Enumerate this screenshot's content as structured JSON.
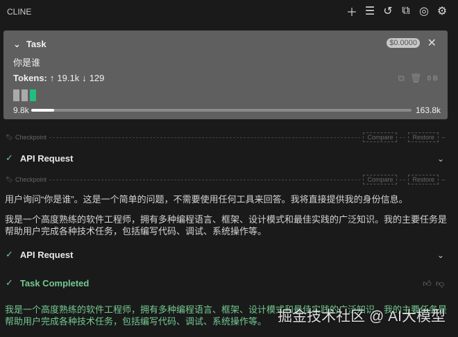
{
  "header": {
    "title": "CLINE"
  },
  "task": {
    "label": "Task",
    "cost": "$0.0000",
    "prompt": "你是谁",
    "tokens_label": "Tokens:",
    "tokens_in": "19.1k",
    "tokens_out": "129",
    "size": "0 B",
    "context_used": "9.8k",
    "context_max": "163.8k",
    "context_fraction": 0.06
  },
  "checkpoint": {
    "label": "Checkpoint",
    "compare": "Compare",
    "restore": "Restore"
  },
  "messages": {
    "api1": "API Request",
    "thinking": "用户询问“你是谁”。这是一个简单的问题，不需要使用任何工具来回答。我将直接提供我的身份信息。",
    "answer": "我是一个高度熟练的软件工程师，拥有多种编程语言、框架、设计模式和最佳实践的广泛知识。我的主要任务是帮助用户完成各种技术任务，包括编写代码、调试、系统操作等。",
    "api2": "API Request",
    "completed": "Task Completed",
    "result": "我是一个高度熟练的软件工程师，拥有多种编程语言、框架、设计模式和最佳实践的广泛知识。我的主要任务是帮助用户完成各种技术任务，包括编写代码、调试、系统操作等。"
  },
  "watermark": "掘金技术社区 @ AI大模型"
}
